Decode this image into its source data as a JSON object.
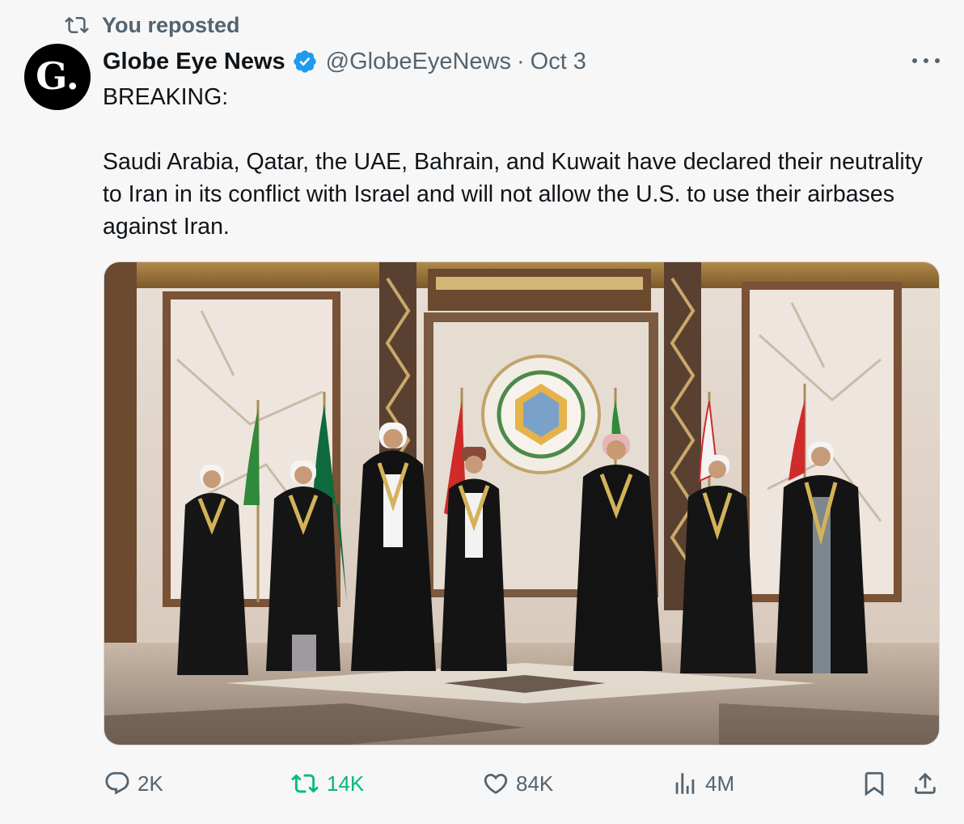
{
  "repost_banner": {
    "label": "You reposted",
    "icon": "repost-icon"
  },
  "author": {
    "display_name": "Globe Eye News",
    "handle": "@GlobeEyeNews",
    "separator": "·",
    "date": "Oct 3",
    "avatar_letter": "G.",
    "verified_color": "#1d9bf0"
  },
  "tweet": {
    "lines": [
      "BREAKING:",
      "Saudi Arabia, Qatar, the UAE, Bahrain, and Kuwait have declared their neutrality to Iran in its conflict with Israel and will not allow the U.S. to use their airbases against Iran."
    ]
  },
  "actions": {
    "reply": {
      "count": "2K",
      "icon": "reply-icon"
    },
    "repost": {
      "count": "14K",
      "icon": "repost-icon",
      "color": "#00ba7c"
    },
    "like": {
      "count": "84K",
      "icon": "heart-icon"
    },
    "views": {
      "count": "4M",
      "icon": "views-icon"
    },
    "bookmark": {
      "icon": "bookmark-icon"
    },
    "share": {
      "icon": "share-icon"
    }
  },
  "colors": {
    "text_secondary": "#536471",
    "text_primary": "#0f1419",
    "background": "#f7f7f7"
  }
}
